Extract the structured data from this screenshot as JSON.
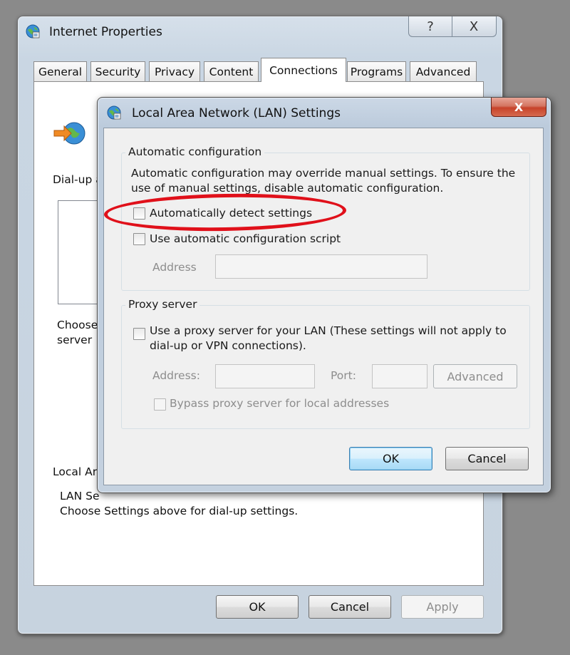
{
  "outer_window": {
    "title": "Internet Properties",
    "help_label": "?",
    "close_label": "X",
    "tabs": [
      "General",
      "Security",
      "Privacy",
      "Content",
      "Connections",
      "Programs",
      "Advanced"
    ],
    "active_tab": "Connections",
    "panel": {
      "dial_up_text": "Dial-up a",
      "choose_text_1": "Choose",
      "choose_text_2": "server",
      "local_area_text": "Local Ar",
      "lan_settings_text": "LAN Se",
      "choose_settings_text": "Choose Settings above for dial-up settings."
    },
    "buttons": {
      "ok": "OK",
      "cancel": "Cancel",
      "apply": "Apply"
    }
  },
  "lan_dialog": {
    "title": "Local Area Network (LAN) Settings",
    "close_label": "X",
    "automatic_configuration": {
      "legend": "Automatic configuration",
      "description_line1": "Automatic configuration may override manual settings.  To ensure the",
      "description_line2": "use of manual settings, disable automatic configuration.",
      "auto_detect_label": "Automatically detect settings",
      "auto_detect_checked": false,
      "auto_script_label": "Use automatic configuration script",
      "auto_script_checked": false,
      "address_label": "Address",
      "address_value": ""
    },
    "proxy_server": {
      "legend": "Proxy server",
      "use_proxy_line1": "Use a proxy server for your LAN (These settings will not apply to",
      "use_proxy_line2": "dial-up or VPN connections).",
      "use_proxy_checked": false,
      "address_label": "Address:",
      "address_value": "",
      "port_label": "Port:",
      "port_value": "",
      "advanced_label": "Advanced",
      "bypass_label": "Bypass proxy server for local addresses",
      "bypass_checked": false
    },
    "buttons": {
      "ok": "OK",
      "cancel": "Cancel"
    }
  },
  "annotation": {
    "color": "#e0101a",
    "target": "Automatically detect settings"
  }
}
